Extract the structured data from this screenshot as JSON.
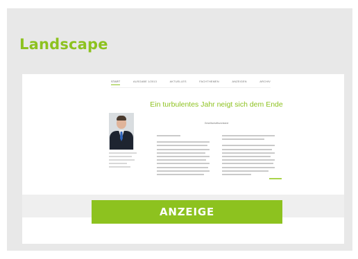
{
  "section": {
    "title": "Landscape"
  },
  "preview": {
    "nav": {
      "items": [
        {
          "label": "Start",
          "active": true
        },
        {
          "label": "Ausgabe 1/2013",
          "active": false
        },
        {
          "label": "Aktuelles",
          "active": false
        },
        {
          "label": "Fachthemen",
          "active": false
        },
        {
          "label": "Anzeigen",
          "active": false
        },
        {
          "label": "Archiv",
          "active": false
        }
      ]
    },
    "headline": "Ein turbulentes Jahr neigt sich dem Ende",
    "subline": "Gesellschaftsvorstand"
  },
  "cta": {
    "label": "ANZEIGE",
    "color": "#8dc21f"
  }
}
